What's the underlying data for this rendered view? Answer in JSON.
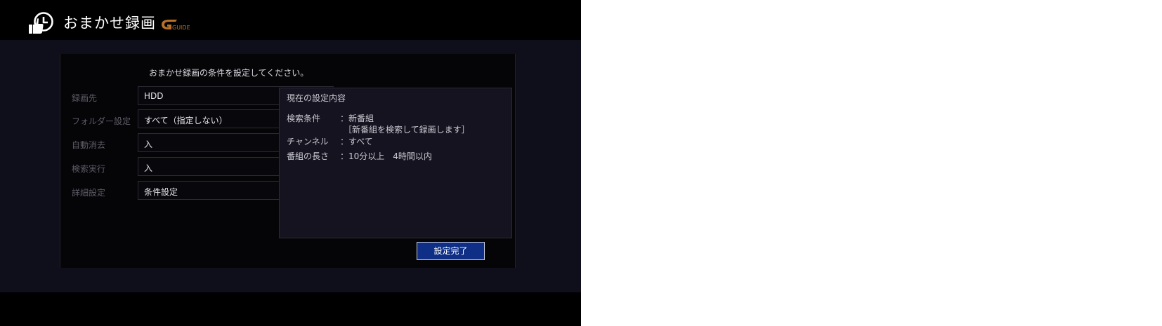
{
  "header": {
    "title": "おまかせ録画",
    "logo_text": "GUIDE",
    "logo_color": "#b8702a"
  },
  "dialog": {
    "instruction": "おまかせ録画の条件を設定してください。",
    "rows": [
      {
        "label": "録画先",
        "value": "HDD"
      },
      {
        "label": "フォルダー設定",
        "value": "すべて（指定しない）"
      },
      {
        "label": "自動消去",
        "value": "入"
      },
      {
        "label": "検索実行",
        "value": "入"
      },
      {
        "label": "詳細設定",
        "value": "条件設定"
      }
    ],
    "summary": {
      "heading": "現在の設定内容",
      "search_key": "検索条件",
      "search_value": "新番組",
      "search_note": "［新番組を検索して録画します］",
      "channel_key": "チャンネル",
      "channel_value": "すべて",
      "length_key": "番組の長さ",
      "length_value": "10分以上　4時間以内",
      "colon": "："
    },
    "done_label": "設定完了"
  },
  "colors": {
    "background": "#0f0e1b",
    "dialog": "#050407",
    "panel": "#15131f",
    "button": "#0f2f86"
  }
}
